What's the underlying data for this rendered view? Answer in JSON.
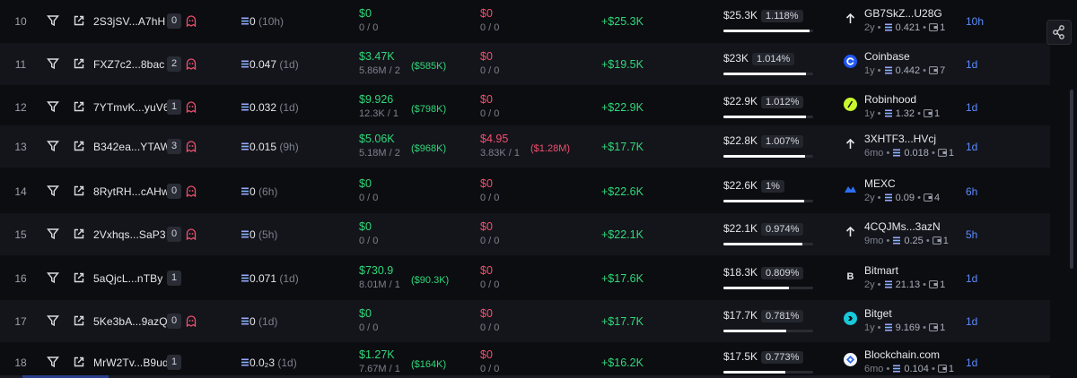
{
  "colors": {
    "green": "#2fd87a",
    "red": "#f0506e",
    "blue_time": "#5b8cff",
    "bg": "#0c0d11",
    "alt_row": "#14151b"
  },
  "rows": [
    {
      "rank": "10",
      "address": "2S3jSV...A7hH",
      "count": "0",
      "ghost": true,
      "hold": "0",
      "hold_ago": "(10h)",
      "bought": "$0",
      "bought_paren": "",
      "bought_sub": "0 / 0",
      "sold": "$0",
      "sold_paren": "",
      "sold_sub": "0 / 0",
      "pnl": "+$25.3K",
      "remaining": "$25.3K",
      "remaining_pct": "1.118%",
      "remaining_fill": 0.96,
      "source_icon": "arrow-up-icon",
      "source": "GB7SkZ...U28G",
      "source_age": "2y",
      "source_bal": "0.421",
      "source_tx": "1",
      "time": "10h"
    },
    {
      "rank": "11",
      "address": "FXZ7c2...8bac",
      "count": "2",
      "ghost": true,
      "hold": "0.047",
      "hold_ago": "(1d)",
      "bought": "$3.47K",
      "bought_paren": "($585K)",
      "bought_sub": "5.86M / 2",
      "sold": "$0",
      "sold_paren": "",
      "sold_sub": "0 / 0",
      "pnl": "+$19.5K",
      "remaining": "$23K",
      "remaining_pct": "1.014%",
      "remaining_fill": 0.92,
      "source_icon": "coinbase-icon",
      "source": "Coinbase",
      "source_age": "1y",
      "source_bal": "0.442",
      "source_tx": "7",
      "time": "1d"
    },
    {
      "rank": "12",
      "address": "7YTmvK...yuV6",
      "count": "1",
      "ghost": true,
      "hold": "0.032",
      "hold_ago": "(1d)",
      "bought": "$9.926",
      "bought_paren": "($798K)",
      "bought_sub": "12.3K / 1",
      "sold": "$0",
      "sold_paren": "",
      "sold_sub": "0 / 0",
      "pnl": "+$22.9K",
      "remaining": "$22.9K",
      "remaining_pct": "1.012%",
      "remaining_fill": 0.92,
      "source_icon": "robinhood-icon",
      "source": "Robinhood",
      "source_age": "1y",
      "source_bal": "1.32",
      "source_tx": "1",
      "time": "1d"
    },
    {
      "rank": "13",
      "address": "B342ea...YTAW",
      "count": "3",
      "ghost": true,
      "hold": "0.015",
      "hold_ago": "(9h)",
      "bought": "$5.06K",
      "bought_paren": "($968K)",
      "bought_sub": "5.18M / 2",
      "sold": "$4.95",
      "sold_paren": "($1.28M)",
      "sold_sub": "3.83K / 1",
      "pnl": "+$17.7K",
      "remaining": "$22.8K",
      "remaining_pct": "1.007%",
      "remaining_fill": 0.91,
      "source_icon": "arrow-up-icon",
      "source": "3XHTF3...HVcj",
      "source_age": "6mo",
      "source_bal": "0.018",
      "source_tx": "1",
      "time": "1d"
    },
    {
      "rank": "14",
      "address": "8RytRH...cAHw",
      "count": "0",
      "ghost": true,
      "hold": "0",
      "hold_ago": "(6h)",
      "bought": "$0",
      "bought_paren": "",
      "bought_sub": "0 / 0",
      "sold": "$0",
      "sold_paren": "",
      "sold_sub": "0 / 0",
      "pnl": "+$22.6K",
      "remaining": "$22.6K",
      "remaining_pct": "1%",
      "remaining_fill": 0.9,
      "source_icon": "mexc-icon",
      "source": "MEXC",
      "source_age": "2y",
      "source_bal": "0.09",
      "source_tx": "4",
      "time": "6h"
    },
    {
      "rank": "15",
      "address": "2Vxhqs...SaP3",
      "count": "0",
      "ghost": true,
      "hold": "0",
      "hold_ago": "(5h)",
      "bought": "$0",
      "bought_paren": "",
      "bought_sub": "0 / 0",
      "sold": "$0",
      "sold_paren": "",
      "sold_sub": "0 / 0",
      "pnl": "+$22.1K",
      "remaining": "$22.1K",
      "remaining_pct": "0.974%",
      "remaining_fill": 0.88,
      "source_icon": "arrow-up-icon",
      "source": "4CQJMs...3azN",
      "source_age": "9mo",
      "source_bal": "0.25",
      "source_tx": "1",
      "time": "5h"
    },
    {
      "rank": "16",
      "address": "5aQjcL...nTBy",
      "count": "1",
      "ghost": false,
      "hold": "0.071",
      "hold_ago": "(1d)",
      "bought": "$730.9",
      "bought_paren": "($90.3K)",
      "bought_sub": "8.01M / 1",
      "sold": "$0",
      "sold_paren": "",
      "sold_sub": "0 / 0",
      "pnl": "+$17.6K",
      "remaining": "$18.3K",
      "remaining_pct": "0.809%",
      "remaining_fill": 0.73,
      "source_icon": "bitmart-icon",
      "source": "Bitmart",
      "source_age": "2y",
      "source_bal": "21.13",
      "source_tx": "1",
      "time": "1d"
    },
    {
      "rank": "17",
      "address": "5Ke3bA...9azQ",
      "count": "0",
      "ghost": true,
      "hold": "0",
      "hold_ago": "(1d)",
      "bought": "$0",
      "bought_paren": "",
      "bought_sub": "0 / 0",
      "sold": "$0",
      "sold_paren": "",
      "sold_sub": "0 / 0",
      "pnl": "+$17.7K",
      "remaining": "$17.7K",
      "remaining_pct": "0.781%",
      "remaining_fill": 0.7,
      "source_icon": "bitget-icon",
      "source": "Bitget",
      "source_age": "1y",
      "source_bal": "9.169",
      "source_tx": "1",
      "time": "1d"
    },
    {
      "rank": "18",
      "address": "MrW2Tv...B9ud",
      "count": "1",
      "ghost": false,
      "hold": "0.0₂3",
      "hold_ago": "(1d)",
      "bought": "$1.27K",
      "bought_paren": "($164K)",
      "bought_sub": "7.67M / 1",
      "sold": "$0",
      "sold_paren": "",
      "sold_sub": "0 / 0",
      "pnl": "+$16.2K",
      "remaining": "$17.5K",
      "remaining_pct": "0.773%",
      "remaining_fill": 0.69,
      "source_icon": "blockchain-com-icon",
      "source": "Blockchain.com",
      "source_age": "6mo",
      "source_bal": "0.104",
      "source_tx": "1",
      "time": "1d"
    }
  ]
}
